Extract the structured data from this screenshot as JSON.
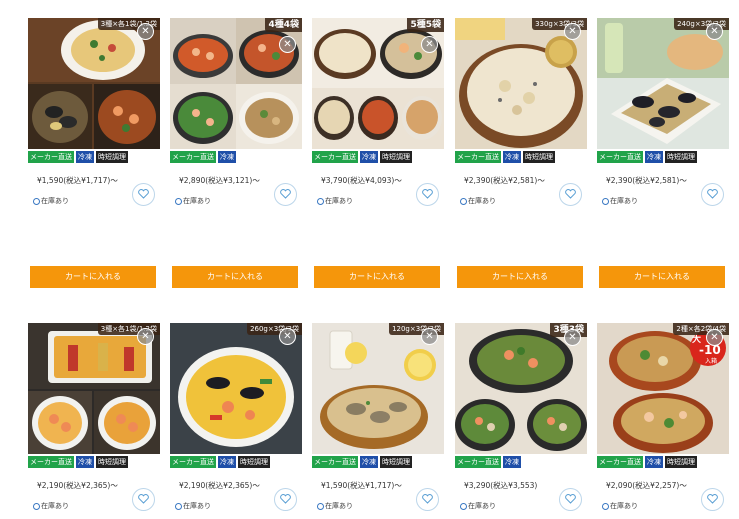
{
  "labels": {
    "cart": "カートに入れる",
    "maker": "メーカー直送",
    "frozen": "冷凍",
    "quick": "時短調理",
    "stock": "在庫あり"
  },
  "products": [
    {
      "qty": "3種×各1袋/1.2袋",
      "price": "¥1,590(税込¥1,717)～"
    },
    {
      "qty": "4種4袋",
      "price": "¥2,890(税込¥3,121)～"
    },
    {
      "qty": "5種5袋",
      "price": "¥3,790(税込¥4,093)～"
    },
    {
      "qty": "330g×3袋/3袋",
      "price": "¥2,390(税込¥2,581)～"
    },
    {
      "qty": "240g×3袋/3袋",
      "price": "¥2,390(税込¥2,581)～"
    },
    {
      "qty": "3種×各1袋/1.2袋",
      "price": "¥2,190(税込¥2,365)～"
    },
    {
      "qty": "260g×3袋/3袋",
      "price": "¥2,190(税込¥2,365)～"
    },
    {
      "qty": "120g×3袋/3袋",
      "price": "¥1,590(税込¥1,717)～"
    },
    {
      "qty": "3種3袋",
      "price": "¥3,290(税込¥3,553)"
    },
    {
      "qty": "2種×各2袋/4袋",
      "price": "¥2,090(税込¥2,257)～"
    }
  ],
  "promo": {
    "text": "大",
    "number": "-10",
    "unit": "入箱"
  },
  "icons": {
    "close": "close-icon",
    "fav": "heart-icon",
    "stock": "circle-icon"
  },
  "colors": {
    "cart": "#f5960b",
    "maker_tag": "#21a34a",
    "frozen_tag": "#1f4fa8",
    "quick_tag": "#222222"
  }
}
